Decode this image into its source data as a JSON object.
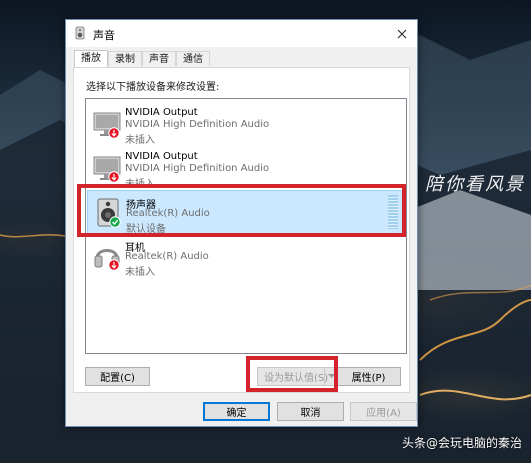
{
  "window": {
    "title": "声音"
  },
  "tabs": [
    "播放",
    "录制",
    "声音",
    "通信"
  ],
  "active_tab": 0,
  "instruction": "选择以下播放设备来修改设置:",
  "devices": [
    {
      "name": "NVIDIA Output",
      "description": "NVIDIA High Definition Audio",
      "status": "未插入",
      "icon": "monitor-icon",
      "badge": "down-arrow-badge",
      "selected": false
    },
    {
      "name": "NVIDIA Output",
      "description": "NVIDIA High Definition Audio",
      "status": "未插入",
      "icon": "monitor-icon",
      "badge": "down-arrow-badge",
      "selected": false
    },
    {
      "name": "扬声器",
      "description": "Realtek(R) Audio",
      "status": "默认设备",
      "icon": "speaker-icon",
      "badge": "checkmark-badge",
      "selected": true
    },
    {
      "name": "耳机",
      "description": "Realtek(R) Audio",
      "status": "未插入",
      "icon": "headphones-icon",
      "badge": "down-arrow-badge",
      "selected": false
    }
  ],
  "buttons": {
    "configure": "配置(C)",
    "set_default": "设为默认值(S)",
    "properties": "属性(P)",
    "ok": "确定",
    "cancel": "取消",
    "apply": "应用(A)"
  },
  "background": {
    "caption": "陪你看风景",
    "watermark_prefix": "头条",
    "watermark_name": "@会玩电脑的秦治"
  },
  "colors": {
    "highlight": "#d3242c",
    "selection": "#cce8ff",
    "accent": "#0078d7"
  }
}
